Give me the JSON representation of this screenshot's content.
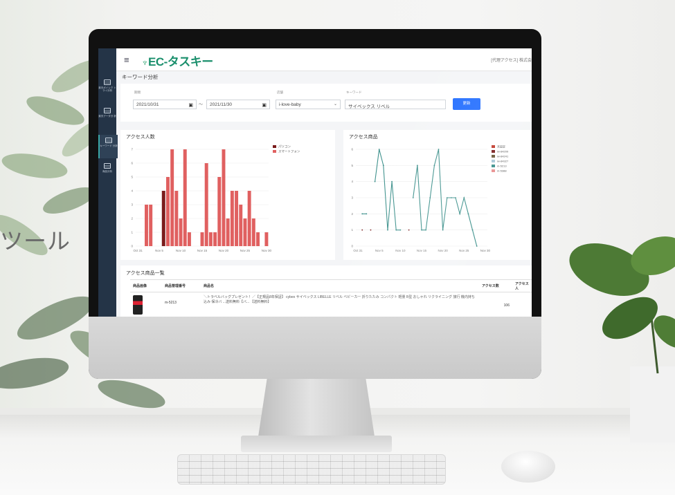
{
  "tagline": "ツール",
  "topbar": {
    "logo": "EC-タスキー",
    "right_text": "[代理アクセス] 株式会"
  },
  "sidebar": {
    "items": [
      {
        "label": "楽天ボイレク トライ分析",
        "icon": "table-icon",
        "active": false
      },
      {
        "label": "楽天データ分 析",
        "icon": "table-icon",
        "active": false
      },
      {
        "label": "キーワード 分析",
        "icon": "table-icon",
        "active": true
      },
      {
        "label": "商品分析",
        "icon": "table-icon",
        "active": false
      }
    ]
  },
  "page": {
    "title": "キーワード分析"
  },
  "filters": {
    "period_label": "期間",
    "date_from": "2021/10/31",
    "separator": "〜",
    "date_to": "2021/11/30",
    "store_label": "店舗",
    "store_value": "i-love-baby",
    "keyword_label": "キーワード",
    "keyword_value": "サイベックス リベル",
    "update_button": "更新"
  },
  "chart_data": [
    {
      "type": "bar",
      "title": "アクセス人数",
      "x": [
        "Oct 31",
        "Nov 1",
        "Nov 2",
        "Nov 3",
        "Nov 4",
        "Nov 5",
        "Nov 6",
        "Nov 7",
        "Nov 8",
        "Nov 9",
        "Nov 10",
        "Nov 11",
        "Nov 12",
        "Nov 13",
        "Nov 14",
        "Nov 15",
        "Nov 16",
        "Nov 17",
        "Nov 18",
        "Nov 19",
        "Nov 20",
        "Nov 21",
        "Nov 22",
        "Nov 23",
        "Nov 24",
        "Nov 25",
        "Nov 26",
        "Nov 27",
        "Nov 28",
        "Nov 29",
        "Nov 30"
      ],
      "tick_labels": [
        "Oct 31",
        "Nov 5",
        "Nov 10",
        "Nov 15",
        "Nov 20",
        "Nov 25",
        "Nov 30"
      ],
      "series": [
        {
          "name": "パソコン",
          "color": "#7a1c1c",
          "values": [
            0,
            0,
            0,
            0,
            0,
            0,
            4,
            0,
            0,
            0,
            0,
            0,
            0,
            0,
            0,
            0,
            0,
            0,
            0,
            0,
            0,
            0,
            0,
            0,
            0,
            0,
            0,
            0,
            0,
            0,
            0
          ]
        },
        {
          "name": "スマートフォン",
          "color": "#e06060",
          "values": [
            0,
            0,
            3,
            3,
            0,
            0,
            0,
            5,
            7,
            4,
            2,
            7,
            1,
            0,
            0,
            1,
            6,
            1,
            1,
            5,
            7,
            2,
            4,
            4,
            3,
            2,
            4,
            2,
            1,
            0,
            1
          ]
        }
      ],
      "ylim": [
        0,
        7
      ],
      "yticks": [
        0,
        1,
        2,
        3,
        4,
        5,
        6,
        7
      ]
    },
    {
      "type": "line",
      "title": "アクセス商品",
      "x": [
        "Oct 31",
        "Nov 1",
        "Nov 2",
        "Nov 3",
        "Nov 4",
        "Nov 5",
        "Nov 6",
        "Nov 7",
        "Nov 8",
        "Nov 9",
        "Nov 10",
        "Nov 11",
        "Nov 12",
        "Nov 13",
        "Nov 14",
        "Nov 15",
        "Nov 16",
        "Nov 17",
        "Nov 18",
        "Nov 19",
        "Nov 20",
        "Nov 21",
        "Nov 22",
        "Nov 23",
        "Nov 24",
        "Nov 25",
        "Nov 26",
        "Nov 27",
        "Nov 28",
        "Nov 29",
        "Nov 30"
      ],
      "tick_labels": [
        "Oct 31",
        "Nov 5",
        "Nov 10",
        "Nov 15",
        "Nov 20",
        "Nov 25",
        "Nov 30"
      ],
      "series": [
        {
          "name": "未設定",
          "color": "#c0392b",
          "values": [
            null,
            null,
            null,
            null,
            null,
            null,
            null,
            null,
            null,
            null,
            null,
            null,
            null,
            null,
            null,
            null,
            null,
            null,
            null,
            null,
            null,
            null,
            null,
            null,
            null,
            null,
            null,
            null,
            null,
            null,
            null
          ]
        },
        {
          "name": "iw-84209",
          "color": "#7a1c1c",
          "values": [
            null,
            1,
            null,
            1,
            null,
            null,
            null,
            null,
            null,
            null,
            null,
            null,
            1,
            null,
            null,
            null,
            null,
            null,
            null,
            null,
            null,
            null,
            null,
            null,
            null,
            null,
            null,
            null,
            null,
            null,
            null
          ]
        },
        {
          "name": "iw-84241",
          "color": "#6b5a3a",
          "values": [
            null,
            null,
            null,
            null,
            null,
            null,
            null,
            null,
            null,
            null,
            null,
            null,
            null,
            null,
            null,
            null,
            null,
            null,
            null,
            null,
            null,
            null,
            null,
            null,
            null,
            null,
            null,
            null,
            null,
            null,
            null
          ]
        },
        {
          "name": "iw-84327",
          "color": "#a8c8d8",
          "values": [
            null,
            null,
            null,
            null,
            null,
            null,
            null,
            null,
            null,
            null,
            null,
            null,
            null,
            null,
            null,
            null,
            null,
            null,
            null,
            null,
            null,
            null,
            null,
            null,
            null,
            null,
            null,
            null,
            null,
            null,
            null
          ]
        },
        {
          "name": "m-5213",
          "color": "#3a8f8a",
          "values": [
            null,
            2,
            2,
            null,
            4,
            6,
            5,
            1,
            4,
            1,
            1,
            null,
            null,
            3,
            5,
            1,
            1,
            3,
            5,
            6,
            1,
            3,
            3,
            3,
            2,
            3,
            2,
            1,
            0,
            null,
            null
          ]
        },
        {
          "name": "m-5388",
          "color": "#e89090",
          "values": [
            null,
            null,
            null,
            null,
            null,
            null,
            null,
            null,
            null,
            null,
            null,
            null,
            null,
            null,
            null,
            null,
            null,
            null,
            null,
            null,
            null,
            null,
            null,
            null,
            null,
            null,
            null,
            null,
            null,
            null,
            null
          ]
        }
      ],
      "ylim": [
        0,
        6
      ],
      "yticks": [
        0,
        1,
        2,
        3,
        4,
        5,
        6
      ]
    }
  ],
  "product_list": {
    "title": "アクセス商品一覧",
    "headers": [
      "商品画像",
      "商品管理番号",
      "商品名",
      "アクセス数",
      "アクセス人"
    ],
    "rows": [
      {
        "code": "m-5213",
        "name": "＼トラベルバッグプレゼント！／【正規品8年保証】 cybex サイベックス LIBELLE リベル ベビーカー 折りたたみ コンパクト 軽量 B型 おしゃれ リクライニング 旅行 機内持ち込み 保冷バ ...送料無料【バ... 【送料無料】",
        "access": "106",
        "image": "stroller-thumbnail"
      }
    ]
  }
}
